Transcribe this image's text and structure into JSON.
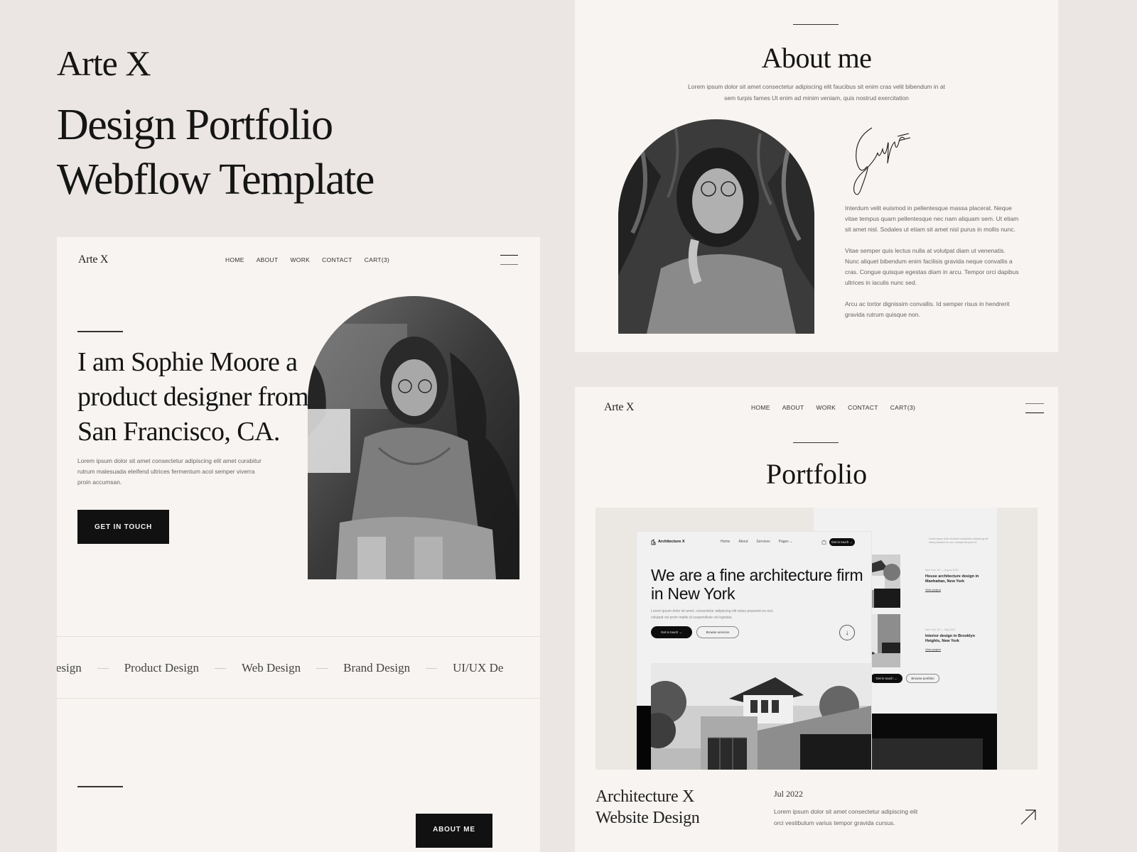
{
  "hero": {
    "brand": "Arte X",
    "title_line1": "Design Portfolio",
    "title_line2": "Webflow Template"
  },
  "site_nav": {
    "logo": "Arte X",
    "links": [
      "HOME",
      "ABOUT",
      "WORK",
      "CONTACT",
      "CART(3)"
    ],
    "menu_icon": "hamburger-icon"
  },
  "home_page": {
    "heading": "I am Sophie Moore a product designer from San Francisco, CA.",
    "paragraph": "Lorem ipsum dolor sit amet consectetur adipiscing elit amet curabitur rutrum malesuada eleifend ultrices fermentum acol semper viverra proin accumsan.",
    "cta": "GET IN TOUCH",
    "photo_alt": "Portrait of woman with glasses seated",
    "services": [
      "X Design",
      "Product Design",
      "Web Design",
      "Brand Design",
      "UI/UX De"
    ],
    "about_button": "ABOUT ME"
  },
  "about_page": {
    "title": "About me",
    "intro": "Lorem ipsum dolor sit amet consectetur adipiscing elit faucibus sit enim cras velit bibendum in at sem turpis fames Ut enim ad minim veniam, quis nostrud exercitation",
    "paragraphs": [
      "Interdum velit euismod in pellentesque massa placerat. Neque vitae tempus quam pellentesque nec nam aliquam sem. Ut etiam sit amet nisl. Sodales ut etiam sit amet nisl purus in mollis nunc.",
      "Vitae semper quis lectus nulla at volutpat diam ut venenatis. Nunc aliquet bibendum enim facilisis gravida neque convallis a cras. Congue quisque egestas diam in arcu. Tempor orci dapibus ultrices in iaculis nunc sed.",
      "Arcu ac tortor dignissim convallis. Id semper risus in hendrerit gravida rutrum quisque non."
    ],
    "photo_alt": "Portrait of woman among leaves",
    "signature_icon": "signature-icon"
  },
  "portfolio_page": {
    "title": "Portfolio",
    "mockup": {
      "logo": "Architecture X",
      "links": [
        "Home",
        "About",
        "Services",
        "Pages ⌄"
      ],
      "cta": "Get in touch →",
      "heading": "We are a fine architecture firm in New York",
      "paragraph": "Lorem ipsum dolor sit amet, consectetur adipiscing elit netus praesent eu orci, volutpat vel proin mattis id suspendisse vel egestas.",
      "btn_primary": "Get in touch →",
      "btn_secondary": "Browse services",
      "back_intro": "Lorem ipsum dolor sit amet consectetur adipiscing elit netus praesent eu orci, volutpat vel proin et.",
      "projects": [
        {
          "meta": "New York, NY  —  August 2020",
          "title": "House architecture design in Manhattan, New York",
          "link": "View project"
        },
        {
          "meta": "New York, NY  —  May 2020",
          "title": "Interior design in Brooklyn Heights, New York",
          "link": "View project"
        }
      ],
      "back_btn_primary": "Get in touch →",
      "back_btn_secondary": "Browse portfolio"
    },
    "project_title_line1": "Architecture X",
    "project_title_line2": "Website Design",
    "project_date": "Jul 2022",
    "project_desc": "Lorem ipsum dolor sit amet consectetur adipiscing elit orci vestibulum varius tempor gravida cursus."
  }
}
